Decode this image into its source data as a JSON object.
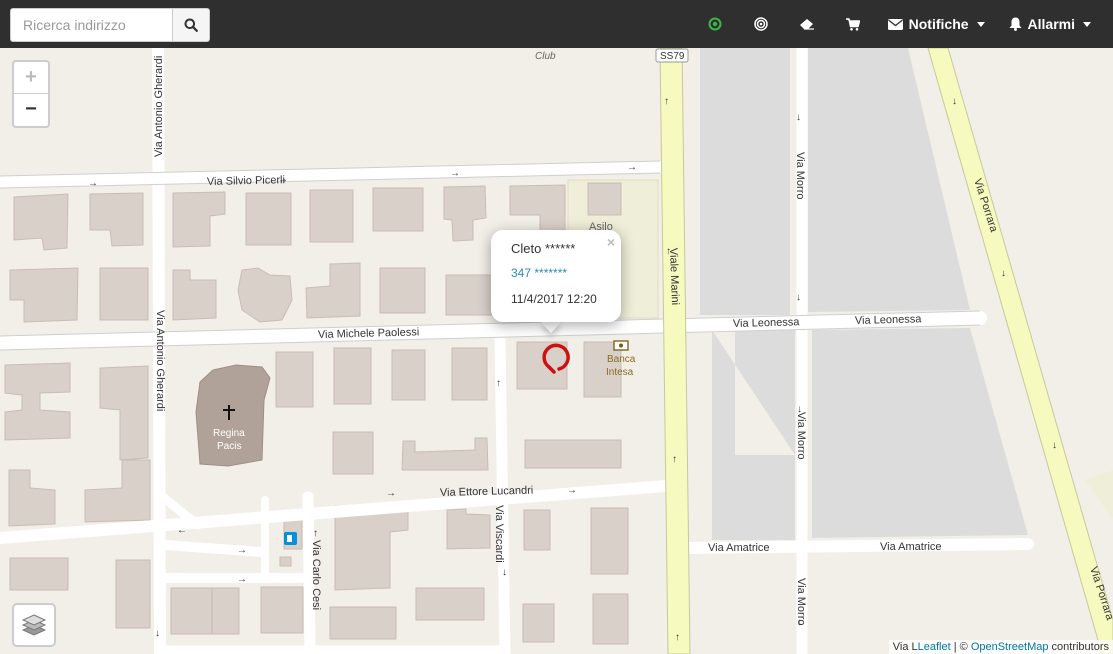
{
  "search": {
    "placeholder": "Ricerca indirizzo"
  },
  "nav": {
    "icons": [
      "target-icon",
      "radar-icon",
      "eraser-icon",
      "cart-icon"
    ],
    "notifiche_label": "Notifiche",
    "allarmi_label": "Allarmi"
  },
  "map": {
    "zoom_in": "+",
    "zoom_out": "−",
    "streets": {
      "via_silvio_picerli": "Via Silvio Picerli",
      "via_antonio_gherardi": "Via Antonio Gherardi",
      "via_michele_paolessi": "Via Michele Paolessi",
      "via_leonessa": "Via Leonessa",
      "viale_marini": "Viale Marini",
      "via_morro": "Via Morro",
      "via_porrara": "Via Porrara",
      "via_ettore_lucandri": "Via Ettore Lucandri",
      "via_viscardi": "Via Viscardi",
      "via_carlo_cesi": "Via Carlo Cesi",
      "via_amatrice": "Via Amatrice",
      "ss79": "SS79"
    },
    "pois": {
      "club": "Club",
      "asilo": "Asilo",
      "church_line1": "Regina",
      "church_line2": "Pacis",
      "bank_line1": "Banca",
      "bank_line2": "Intesa"
    },
    "popup": {
      "name": "Cleto ******",
      "phone": "347 *******",
      "datetime": "11/4/2017 12:20",
      "close": "×"
    },
    "attribution": {
      "prefix": "Via L",
      "leaflet": "Leaflet",
      "sep": " | © ",
      "osm": "OpenStreetMap",
      "suffix": " contributors"
    }
  },
  "colors": {
    "topbar": "#2f2f2f",
    "map_bg": "#f2efe9",
    "building": "#d9d0c9",
    "primary_road": "#f7fabf",
    "church": "#b0a298",
    "marker": "#cc1111",
    "active_green": "#3bb54a"
  }
}
